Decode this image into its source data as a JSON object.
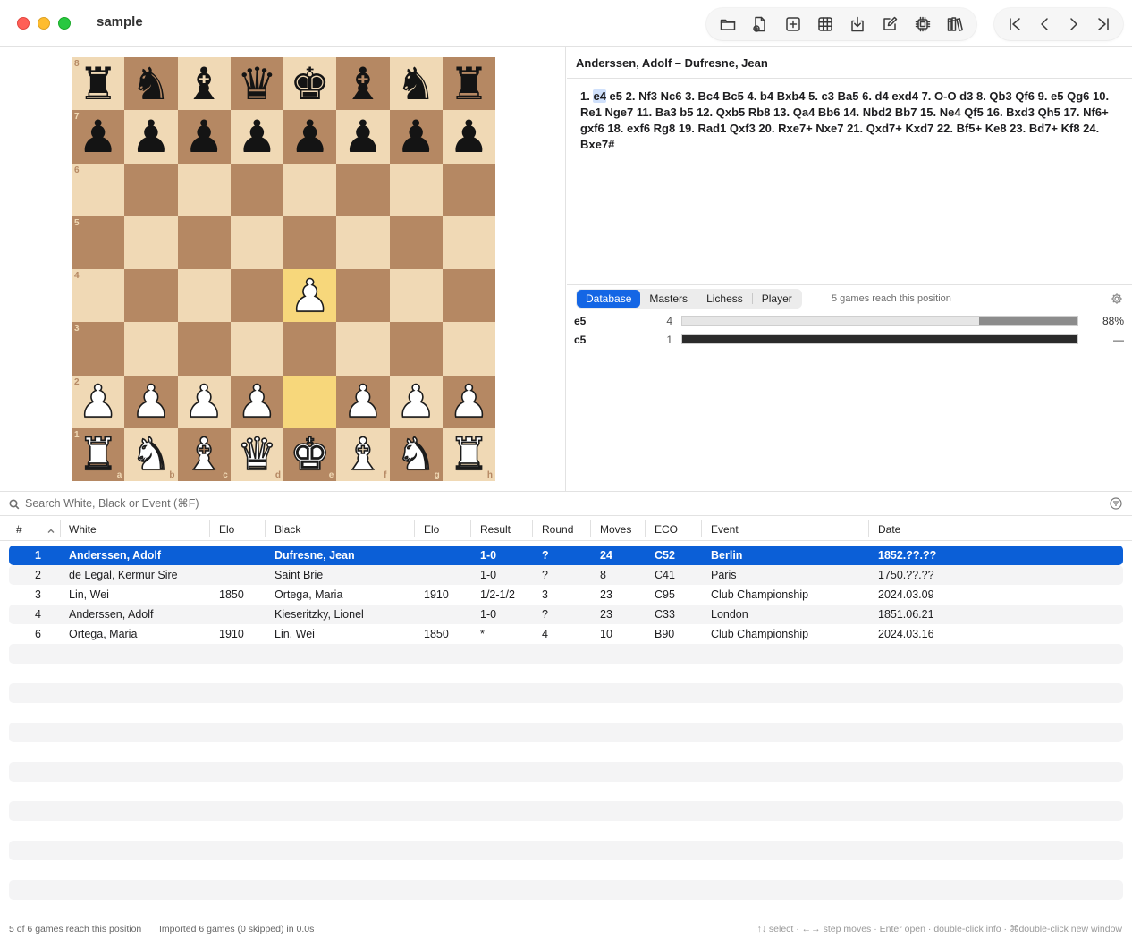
{
  "window": {
    "title": "sample",
    "toolbar": [
      "folder-icon",
      "new-document-icon",
      "add-game-icon",
      "grid-icon",
      "download-icon",
      "edit-icon",
      "engine-chip-icon",
      "library-icon"
    ],
    "nav": [
      "first-move-icon",
      "previous-move-icon",
      "next-move-icon",
      "last-move-icon"
    ]
  },
  "board": {
    "highlight_squares": [
      "e4",
      "e2"
    ],
    "pieces": {
      "a8": "bR",
      "b8": "bN",
      "c8": "bB",
      "d8": "bQ",
      "e8": "bK",
      "f8": "bB",
      "g8": "bN",
      "h8": "bR",
      "a7": "bP",
      "b7": "bP",
      "c7": "bP",
      "d7": "bP",
      "e7": "bP",
      "f7": "bP",
      "g7": "bP",
      "h7": "bP",
      "e4": "wP",
      "a2": "wP",
      "b2": "wP",
      "c2": "wP",
      "d2": "wP",
      "f2": "wP",
      "g2": "wP",
      "h2": "wP",
      "a1": "wR",
      "b1": "wN",
      "c1": "wB",
      "d1": "wQ",
      "e1": "wK",
      "f1": "wB",
      "g1": "wN",
      "h1": "wR"
    },
    "ranks": [
      "8",
      "7",
      "6",
      "5",
      "4",
      "3",
      "2",
      "1"
    ],
    "files": [
      "a",
      "b",
      "c",
      "d",
      "e",
      "f",
      "g",
      "h"
    ],
    "colors": {
      "light": "#f0d9b5",
      "dark": "#b58863",
      "highlight": "#f7d77b"
    }
  },
  "game": {
    "title": "Anderssen, Adolf – Dufresne, Jean",
    "moves_prefix": "1. ",
    "current_move": "e4",
    "moves_rest": " e5 2. Nf3 Nc6 3. Bc4 Bc5 4. b4 Bxb4 5. c3 Ba5 6. d4 exd4 7. O-O d3 8. Qb3 Qf6 9. e5 Qg6 10. Re1 Nge7 11. Ba3 b5 12. Qxb5 Rb8 13. Qa4 Bb6 14. Nbd2 Bb7 15. Ne4 Qf5 16. Bxd3 Qh5 17. Nf6+ gxf6 18. exf6 Rg8 19. Rad1 Qxf3 20. Rxe7+ Nxe7 21. Qxd7+ Kxd7 22. Bf5+ Ke8 23. Bd7+ Kf8 24. Bxe7#"
  },
  "explorer": {
    "tabs": [
      {
        "label": "Database",
        "active": true
      },
      {
        "label": "Masters",
        "active": false
      },
      {
        "label": "Lichess",
        "active": false
      },
      {
        "label": "Player",
        "active": false
      }
    ],
    "summary": "5 games reach this position",
    "rows": [
      {
        "move": "e5",
        "count": "4",
        "pct": "88%",
        "white": 0.75,
        "draw": 0.0,
        "black": 0.25
      },
      {
        "move": "c5",
        "count": "1",
        "pct": "—",
        "white": 0.0,
        "draw": 0.0,
        "black": 1.0
      }
    ]
  },
  "search": {
    "placeholder": "Search White, Black or Event (⌘F)"
  },
  "table": {
    "columns": [
      "#",
      "White",
      "Elo",
      "Black",
      "Elo",
      "Result",
      "Round",
      "Moves",
      "ECO",
      "Event",
      "Date"
    ],
    "rows": [
      {
        "num": "1",
        "white": "Anderssen, Adolf",
        "welo": "",
        "black": "Dufresne, Jean",
        "belo": "",
        "result": "1-0",
        "round": "?",
        "moves": "24",
        "eco": "C52",
        "event": "Berlin",
        "date": "1852.??.??",
        "selected": true
      },
      {
        "num": "2",
        "white": "de Legal, Kermur Sire",
        "welo": "",
        "black": "Saint Brie",
        "belo": "",
        "result": "1-0",
        "round": "?",
        "moves": "8",
        "eco": "C41",
        "event": "Paris",
        "date": "1750.??.??",
        "selected": false
      },
      {
        "num": "3",
        "white": "Lin, Wei",
        "welo": "1850",
        "black": "Ortega, Maria",
        "belo": "1910",
        "result": "1/2-1/2",
        "round": "3",
        "moves": "23",
        "eco": "C95",
        "event": "Club Championship",
        "date": "2024.03.09",
        "selected": false
      },
      {
        "num": "4",
        "white": "Anderssen, Adolf",
        "welo": "",
        "black": "Kieseritzky, Lionel",
        "belo": "",
        "result": "1-0",
        "round": "?",
        "moves": "23",
        "eco": "C33",
        "event": "London",
        "date": "1851.06.21",
        "selected": false
      },
      {
        "num": "6",
        "white": "Ortega, Maria",
        "welo": "1910",
        "black": "Lin, Wei",
        "belo": "1850",
        "result": "*",
        "round": "4",
        "moves": "10",
        "eco": "B90",
        "event": "Club Championship",
        "date": "2024.03.16",
        "selected": false
      }
    ]
  },
  "status": {
    "left": "5 of 6 games reach this position",
    "middle": "Imported 6 games (0 skipped) in 0.0s",
    "right": "↑↓ select · ←→ step moves · Enter open · double-click info · ⌘double-click new window"
  }
}
